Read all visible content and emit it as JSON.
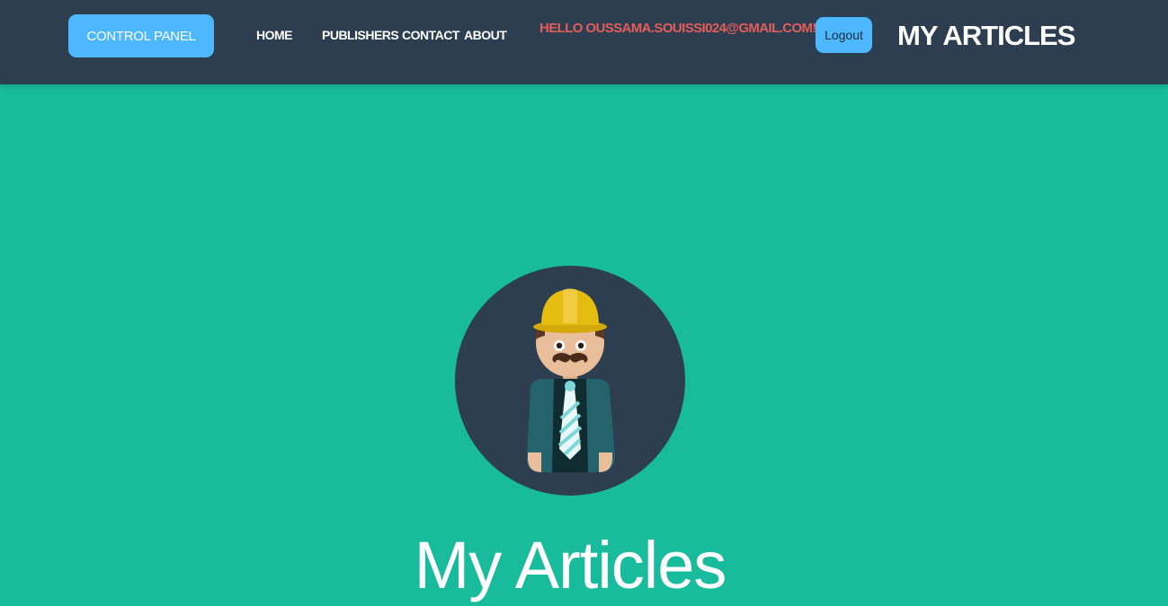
{
  "navbar": {
    "control_panel_label": "CONTROL PANEL",
    "links": [
      {
        "label": "HOME"
      },
      {
        "label": "PUBLISHERS"
      },
      {
        "label": "CONTACT"
      },
      {
        "label": "ABOUT"
      }
    ],
    "greeting": "HELLO OUSSAMA.SOUISSI024@GMAIL.COM!",
    "logout_label": "Logout",
    "brand": "MY ARTICLES"
  },
  "masthead": {
    "avatar_icon": "construction-worker-avatar-icon",
    "heading": "My Articles"
  },
  "colors": {
    "navbar_bg": "#2c3e50",
    "page_bg": "#18bc9c",
    "button_bg": "#4db8ff",
    "greeting_text": "#e35d5b"
  }
}
